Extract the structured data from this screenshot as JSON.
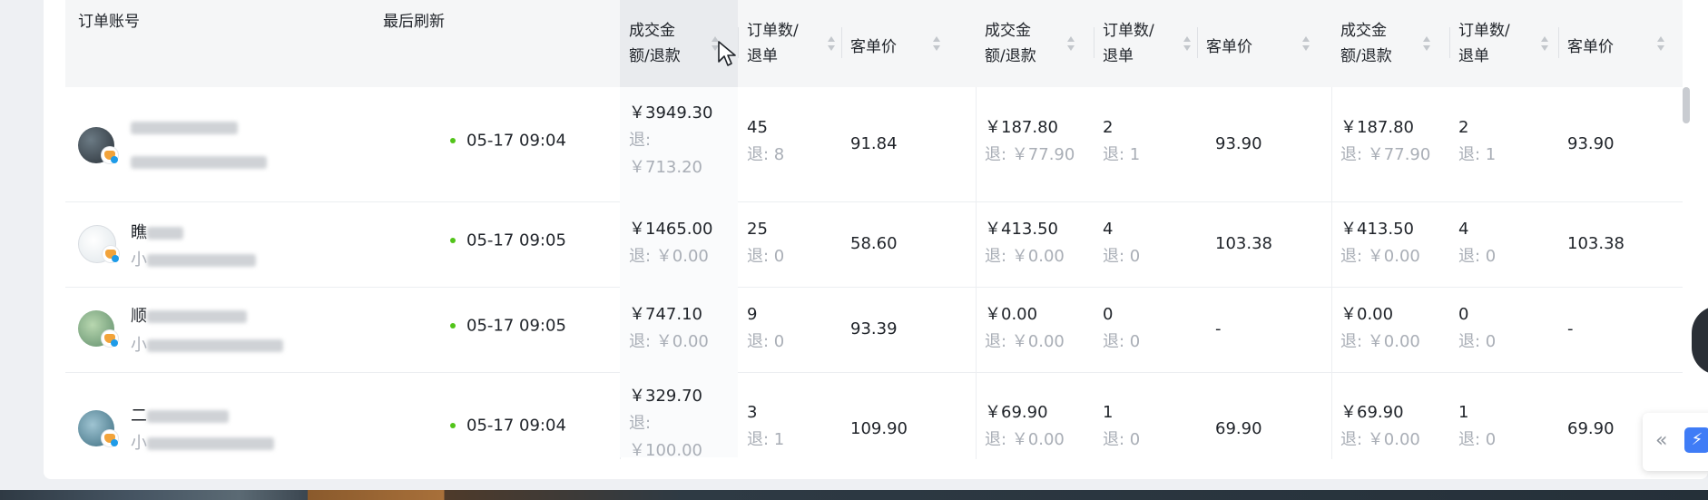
{
  "header": {
    "account": "订单账号",
    "refresh": "最后刷新",
    "groups": [
      {
        "amount": "成交金\n额/退款",
        "orders": "订单数/\n退单",
        "avg": "客单价"
      },
      {
        "amount": "成交金\n额/退款",
        "orders": "订单数/\n退单",
        "avg": "客单价"
      },
      {
        "amount": "成交金\n额/退款",
        "orders": "订单数/\n退单",
        "avg": "客单价"
      }
    ]
  },
  "rows": [
    {
      "name_prefix": "",
      "time": "05-17 09:04",
      "groups": [
        {
          "amount": "￥3949.30",
          "refund_label": "退:",
          "refund": "￥713.20",
          "orders": "45",
          "orders_refund": "退: 8",
          "avg": "91.84"
        },
        {
          "amount": "￥187.80",
          "refund": "退: ￥77.90",
          "orders": "2",
          "orders_refund": "退: 1",
          "avg": "93.90"
        },
        {
          "amount": "￥187.80",
          "refund": "退: ￥77.90",
          "orders": "2",
          "orders_refund": "退: 1",
          "avg": "93.90"
        }
      ]
    },
    {
      "name_prefix": "瞧",
      "sub_prefix": "小",
      "time": "05-17 09:05",
      "groups": [
        {
          "amount": "￥1465.00",
          "refund": "退: ￥0.00",
          "orders": "25",
          "orders_refund": "退: 0",
          "avg": "58.60"
        },
        {
          "amount": "￥413.50",
          "refund": "退: ￥0.00",
          "orders": "4",
          "orders_refund": "退: 0",
          "avg": "103.38"
        },
        {
          "amount": "￥413.50",
          "refund": "退: ￥0.00",
          "orders": "4",
          "orders_refund": "退: 0",
          "avg": "103.38"
        }
      ]
    },
    {
      "name_prefix": "顺",
      "sub_prefix": "小",
      "time": "05-17 09:05",
      "groups": [
        {
          "amount": "￥747.10",
          "refund": "退: ￥0.00",
          "orders": "9",
          "orders_refund": "退: 0",
          "avg": "93.39"
        },
        {
          "amount": "￥0.00",
          "refund": "退: ￥0.00",
          "orders": "0",
          "orders_refund": "退: 0",
          "avg": "-"
        },
        {
          "amount": "￥0.00",
          "refund": "退: ￥0.00",
          "orders": "0",
          "orders_refund": "退: 0",
          "avg": "-"
        }
      ]
    },
    {
      "name_prefix": "二",
      "sub_prefix": "小",
      "time": "05-17 09:04",
      "groups": [
        {
          "amount": "￥329.70",
          "refund_label": "退:",
          "refund": "￥100.00",
          "orders": "3",
          "orders_refund": "退: 1",
          "avg": "109.90"
        },
        {
          "amount": "￥69.90",
          "refund": "退: ￥0.00",
          "orders": "1",
          "orders_refund": "退: 0",
          "avg": "69.90"
        },
        {
          "amount": "￥69.90",
          "refund": "退: ￥0.00",
          "orders": "1",
          "orders_refund": "退: 0",
          "avg": "69.90"
        }
      ]
    }
  ],
  "side_widget": {
    "collapse_icon": "«",
    "bolt_icon": "⚡"
  },
  "colors": {
    "status_online": "#52c41a",
    "accent": "#3f7cf6"
  }
}
